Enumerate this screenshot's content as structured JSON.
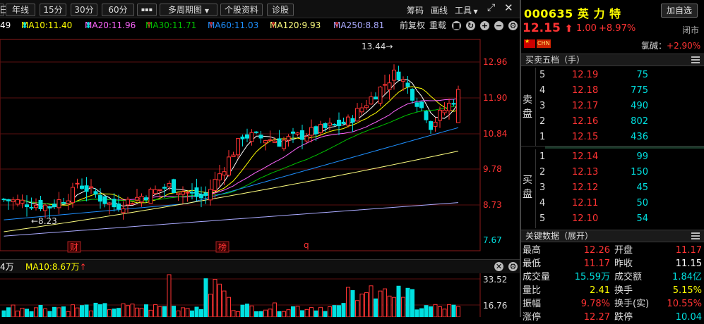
{
  "toolbar": {
    "b1": "日",
    "b2": "年线",
    "b3": "15分",
    "b4": "30分",
    "b5": "60分",
    "more": "▪▪▪",
    "multi": "多周期图",
    "info": "个股资料",
    "diag": "诊股",
    "chips": "筹码",
    "draw": "画线",
    "tools": "工具"
  },
  "ma_line": {
    "cut": "49",
    "ma10": "MA10:11.40",
    "ma20": "MA20:11.96",
    "ma30": "MA30:11.71",
    "ma60": "MA60:11.03",
    "ma120": "MA120:9.93",
    "ma250": "MA250:8.81",
    "fuquan": "前复权",
    "overlay": "重载"
  },
  "price_axis": [
    "12.96",
    "11.90",
    "10.84",
    "9.78",
    "8.73",
    "7.67"
  ],
  "annotations": {
    "high": "13.44→",
    "low": "←8.23",
    "m1": "财",
    "m2": "榜",
    "m3": "q"
  },
  "vol_header": {
    "a": "4万",
    "ma10": "MA10:8.67万"
  },
  "vol_axis": [
    "33.52",
    "16.76"
  ],
  "stock": {
    "code": "000635",
    "name": "英 力 特",
    "add_btn": "加自选",
    "price": "12.15",
    "arrow": "⬆",
    "change": "1.00",
    "pct": "+8.97%",
    "status": "闭市",
    "tag": "CHN",
    "sector": "氯碱：",
    "sector_pct": "+2.90%"
  },
  "orderbook": {
    "title": "买卖五档（手）",
    "sell_label1": "卖",
    "sell_label2": "盘",
    "buy_label1": "买",
    "buy_label2": "盘",
    "asks": [
      {
        "n": "5",
        "p": "12.19",
        "v": "75"
      },
      {
        "n": "4",
        "p": "12.18",
        "v": "775"
      },
      {
        "n": "3",
        "p": "12.17",
        "v": "490"
      },
      {
        "n": "2",
        "p": "12.16",
        "v": "802"
      },
      {
        "n": "1",
        "p": "12.15",
        "v": "436"
      }
    ],
    "bids": [
      {
        "n": "1",
        "p": "12.14",
        "v": "99"
      },
      {
        "n": "2",
        "p": "12.13",
        "v": "150"
      },
      {
        "n": "3",
        "p": "12.12",
        "v": "45"
      },
      {
        "n": "4",
        "p": "12.11",
        "v": "50"
      },
      {
        "n": "5",
        "p": "12.10",
        "v": "54"
      }
    ]
  },
  "keydata": {
    "title": "关键数据（展开）",
    "rows": [
      {
        "l1": "最高",
        "v1": "12.26",
        "l2": "开盘",
        "v2": "11.17"
      },
      {
        "l1": "最低",
        "v1": "11.17",
        "l2": "昨收",
        "v2": "11.15"
      },
      {
        "l1": "成交量",
        "v1": "15.59万",
        "l2": "成交额",
        "v2": "1.84亿"
      },
      {
        "l1": "量比",
        "v1": "2.41",
        "l2": "换手",
        "v2": "5.15%"
      },
      {
        "l1": "振幅",
        "v1": "9.78%",
        "l2": "换手(实)",
        "v2": "10.55%"
      },
      {
        "l1": "涨停",
        "v1": "12.27",
        "l2": "跌停",
        "v2": "10.04"
      }
    ]
  },
  "colors": {
    "up": "#ff3333",
    "down": "#00e0e0",
    "ma5": "#ffffff",
    "ma10": "#ffff00",
    "ma20": "#ff66ff",
    "ma30": "#00c000",
    "ma60": "#1e90ff",
    "ma120": "#ffff80",
    "ma250": "#aaaaff"
  }
}
